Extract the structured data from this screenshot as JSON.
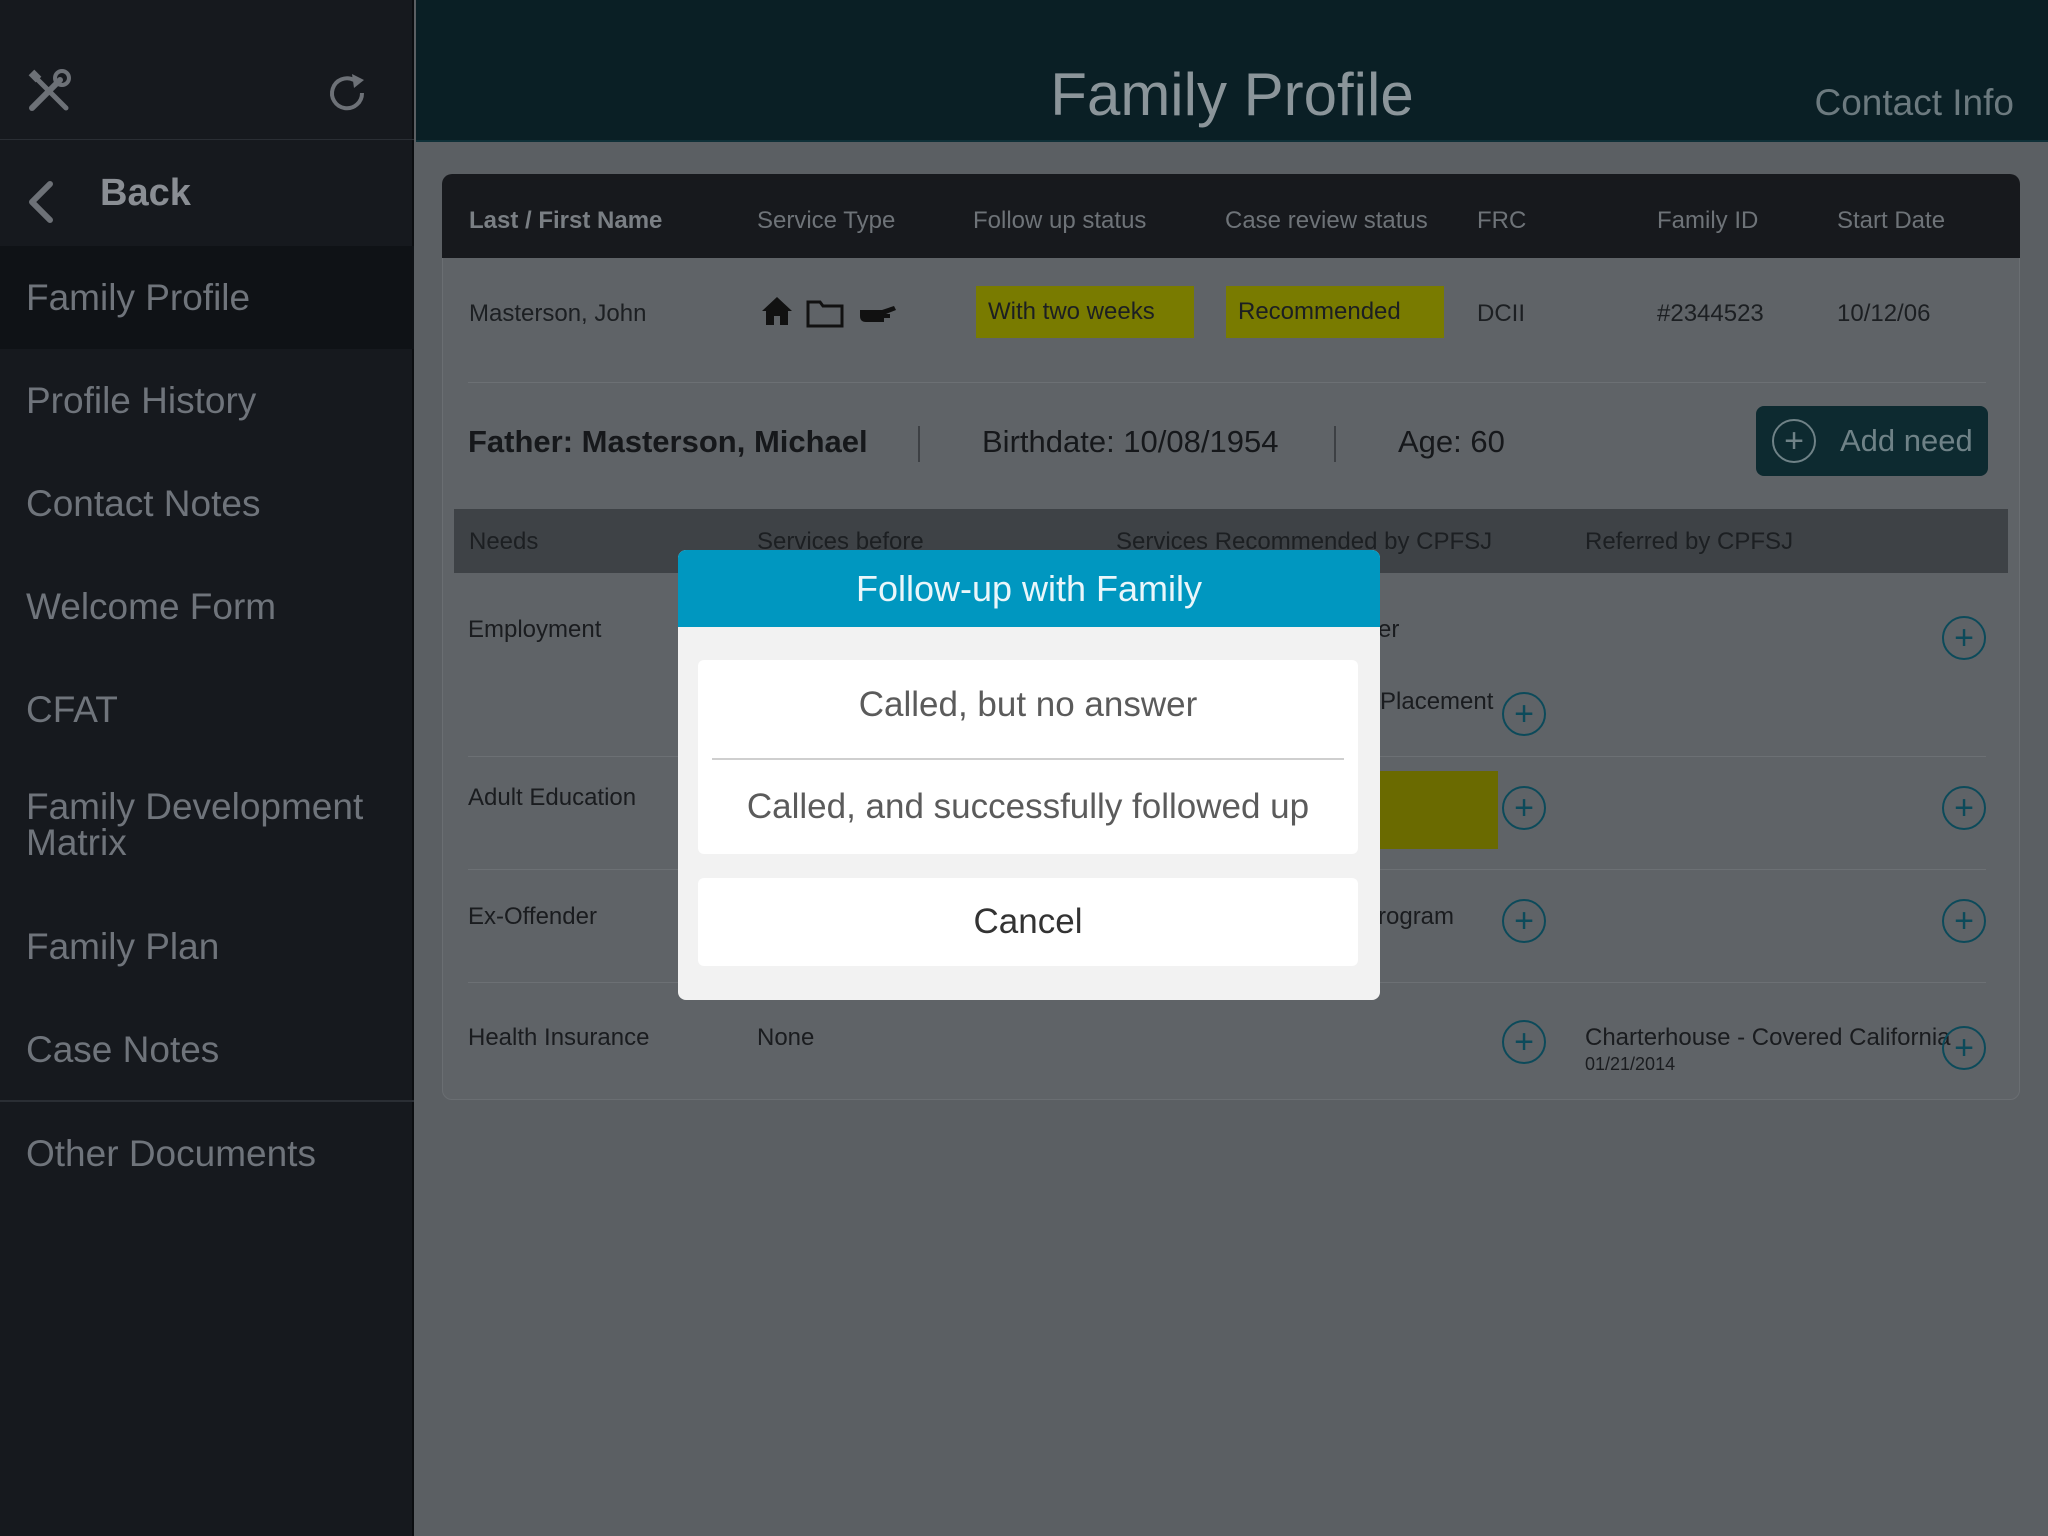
{
  "sidebar": {
    "back_label": "Back",
    "items": [
      {
        "label": "Family Profile",
        "active": true
      },
      {
        "label": "Profile History"
      },
      {
        "label": "Contact Notes"
      },
      {
        "label": "Welcome Form"
      },
      {
        "label": "CFAT"
      },
      {
        "label": "Family Development Matrix"
      },
      {
        "label": "Family Plan"
      },
      {
        "label": "Case Notes"
      },
      {
        "label": "Other Documents"
      }
    ],
    "icons": [
      "tools-icon",
      "refresh-icon",
      "chevron-left-icon"
    ]
  },
  "header": {
    "title": "Family Profile",
    "contact_link": "Contact Info"
  },
  "summary_table": {
    "headers": [
      "Last / First Name",
      "Service Type",
      "Follow up status",
      "Case review status",
      "FRC",
      "Family ID",
      "Start Date"
    ],
    "row": {
      "name": "Masterson, John",
      "service_icons": [
        "house-icon",
        "folder-icon",
        "hand-icon"
      ],
      "follow_up": "With two weeks",
      "case_review": "Recommended",
      "frc": "DCII",
      "family_id": "#2344523",
      "start_date": "10/12/06"
    }
  },
  "member": {
    "name": "Father: Masterson, Michael",
    "birthdate": "Birthdate: 10/08/1954",
    "age": "Age: 60",
    "add_need_label": "Add need",
    "add_symbol": "+"
  },
  "needs_table": {
    "headers": [
      "Needs",
      "Services before",
      "Services Recommended by CPFSJ",
      "Referred by CPFSJ"
    ],
    "rows": [
      {
        "need": "Employment",
        "partial_top": "er",
        "partial_recommended": "Placement"
      },
      {
        "need": "Adult Education"
      },
      {
        "need": "Ex-Offender",
        "partial_recommended": "rogram"
      },
      {
        "need": "Health Insurance",
        "services_before": "None",
        "referred": "Charterhouse - Covered California",
        "referred_date": "01/21/2014"
      }
    ]
  },
  "dialog": {
    "title": "Follow-up with Family",
    "options": [
      "Called, but no answer",
      "Called, and successfully followed up"
    ],
    "cancel_label": "Cancel"
  },
  "colors": {
    "dialog_header": "#0097c0",
    "status_highlight": "#cccc00",
    "header_bg": "#0a1f25"
  }
}
